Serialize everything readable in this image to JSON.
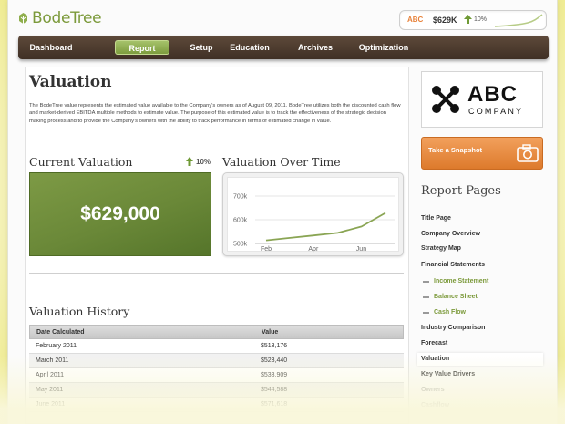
{
  "brand": {
    "name": "BodeTree"
  },
  "ticker": {
    "company": "ABC",
    "value": "$629K",
    "change": "10%"
  },
  "nav": {
    "items": [
      {
        "label": "Dashboard"
      },
      {
        "label": "Report"
      },
      {
        "label": "Setup"
      },
      {
        "label": "Education"
      },
      {
        "label": "Archives"
      },
      {
        "label": "Optimization"
      }
    ],
    "active": "Report"
  },
  "page": {
    "title": "Valuation",
    "intro": "The BodeTree value represents the estimated value available to the Company's owners as of August 09, 2011. BodeTree utilizes both the discounted cash flow and market-derived EBITDA multiple methods to estimate value. The purpose of this estimated value is to track the effectiveness of the strategic decision making process and to provide the Company's owners with the ability to track performance in terms of estimated change in value."
  },
  "current_valuation": {
    "heading": "Current Valuation",
    "change": "10%",
    "value": "$629,000"
  },
  "valuation_chart": {
    "heading": "Valuation Over Time",
    "y_ticks": [
      "700k",
      "600k",
      "500k"
    ],
    "x_ticks": [
      "Feb",
      "Apr",
      "Jun"
    ]
  },
  "chart_data": {
    "type": "line",
    "title": "Valuation Over Time",
    "x": [
      "Feb",
      "Mar",
      "Apr",
      "May",
      "Jun",
      "Jul"
    ],
    "values": [
      513176,
      523440,
      533909,
      544588,
      571618,
      629000
    ],
    "ylim": [
      500000,
      700000
    ],
    "xlabel": "",
    "ylabel": "",
    "grid": true,
    "line_color": "#8aa554"
  },
  "history": {
    "heading": "Valuation History",
    "columns": [
      "Date Calculated",
      "Value"
    ],
    "rows": [
      [
        "February 2011",
        "$513,176"
      ],
      [
        "March 2011",
        "$523,440"
      ],
      [
        "April 2011",
        "$533,909"
      ],
      [
        "May 2011",
        "$544,588"
      ],
      [
        "June 2011",
        "$571,618"
      ]
    ]
  },
  "company_logo": {
    "name": "ABC",
    "tagline": "COMPANY"
  },
  "snapshot": {
    "label": "Take a Snapshot"
  },
  "report_pages": {
    "title": "Report Pages",
    "items": [
      {
        "label": "Title Page",
        "sub": false
      },
      {
        "label": "Company Overview",
        "sub": false
      },
      {
        "label": "Strategy Map",
        "sub": false
      },
      {
        "label": "Financial Statements",
        "sub": false
      },
      {
        "label": "Income Statement",
        "sub": true
      },
      {
        "label": "Balance Sheet",
        "sub": true
      },
      {
        "label": "Cash Flow",
        "sub": true
      },
      {
        "label": "Industry Comparison",
        "sub": false
      },
      {
        "label": "Forecast",
        "sub": false
      },
      {
        "label": "Valuation",
        "sub": false
      },
      {
        "label": "Key Value Drivers",
        "sub": false
      },
      {
        "label": "Owners",
        "sub": false
      },
      {
        "label": "Cashflow",
        "sub": false
      }
    ],
    "current": "Valuation"
  },
  "colors": {
    "brand_green": "#7c9a3b",
    "accent_orange": "#e8823a",
    "nav_brown": "#4b3a2d"
  }
}
